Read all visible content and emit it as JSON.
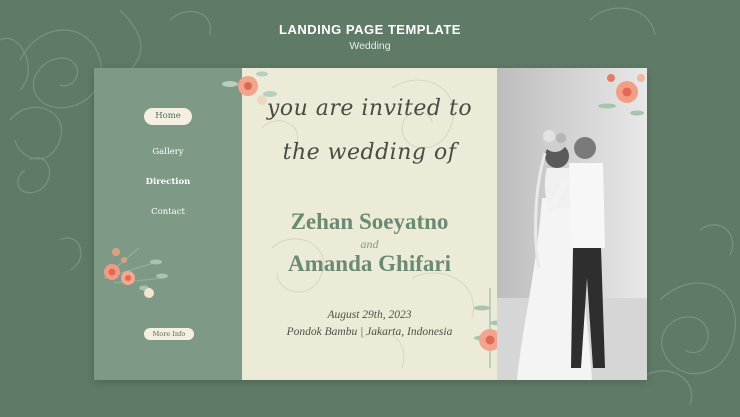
{
  "header": {
    "title": "LANDING PAGE TEMPLATE",
    "subtitle": "Wedding"
  },
  "nav": {
    "items": [
      {
        "label": "Home"
      },
      {
        "label": "Gallery"
      },
      {
        "label": "Direction"
      },
      {
        "label": "Contact"
      }
    ],
    "more_label": "More Info"
  },
  "invitation": {
    "line1": "you are invited to",
    "line2": "the wedding of",
    "name1": "Zehan Soeyatno",
    "and": "and",
    "name2": "Amanda Ghifari",
    "date": "August 29th, 2023",
    "place": "Pondok Bambu | Jakarta, Indonesia"
  },
  "colors": {
    "background": "#5f7b67",
    "sidebar": "#7e9a86",
    "paper": "#ecebd7",
    "accent_green": "#6b8a74",
    "flower": "#f08a76"
  },
  "icons": [
    "rose-outline-art",
    "flower-bouquet",
    "couple-photo"
  ]
}
